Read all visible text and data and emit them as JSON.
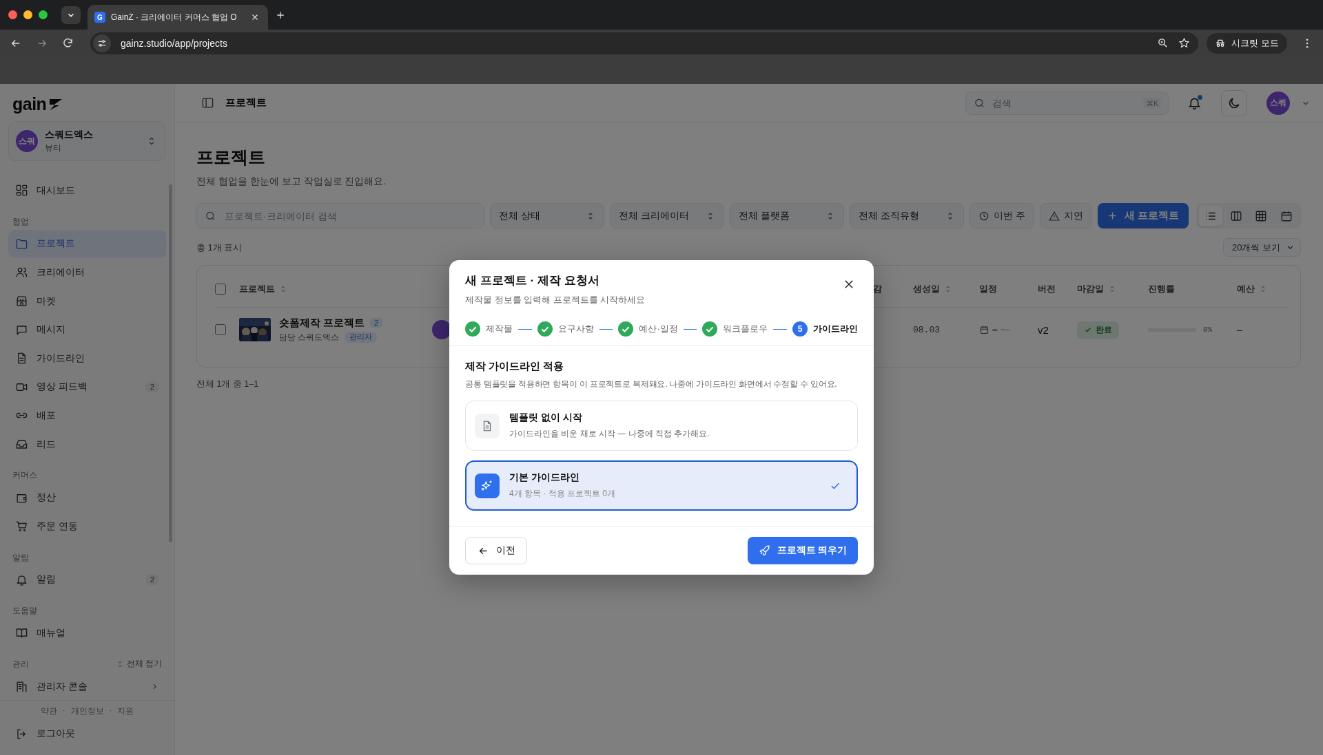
{
  "browser": {
    "favicon": "G",
    "tab_title": "GainZ · 크리에이터 커머스 협업 O",
    "url": "gainz.studio/app/projects",
    "incognito_label": "시크릿 모드"
  },
  "sidebar": {
    "logo": "gain",
    "workspace": {
      "avatar": "스쿼",
      "name": "스쿼드엑스",
      "category": "뷰티"
    },
    "sections": [
      {
        "items": [
          {
            "label": "대시보드",
            "selected": false
          }
        ]
      },
      {
        "label": "협업",
        "items": [
          {
            "label": "프로젝트",
            "selected": true
          },
          {
            "label": "크리에이터",
            "selected": false
          },
          {
            "label": "마켓",
            "selected": false
          },
          {
            "label": "메시지",
            "selected": false
          },
          {
            "label": "가이드라인",
            "selected": false
          },
          {
            "label": "영상 피드백",
            "selected": false,
            "badge": "2"
          },
          {
            "label": "배포",
            "selected": false
          },
          {
            "label": "리드",
            "selected": false
          }
        ]
      },
      {
        "label": "커머스",
        "items": [
          {
            "label": "정산",
            "selected": false
          },
          {
            "label": "주문 연동",
            "selected": false
          }
        ]
      },
      {
        "label": "알림",
        "items": [
          {
            "label": "알림",
            "selected": false,
            "badge": "2"
          }
        ]
      },
      {
        "label": "도움말",
        "items": [
          {
            "label": "매뉴얼",
            "selected": false
          }
        ]
      },
      {
        "label": "관리",
        "action": "전체 접기",
        "items": [
          {
            "label": "관리자 콘솔",
            "selected": false
          }
        ]
      }
    ],
    "footer_links": [
      "약관",
      "개인정보",
      "지원"
    ],
    "footer_separator": "·",
    "logout": "로그아웃"
  },
  "header": {
    "title": "프로젝트",
    "search_placeholder": "검색",
    "shortcut": "⌘K",
    "notification_unread": true,
    "avatar": "스쿼"
  },
  "page": {
    "title": "프로젝트",
    "subtitle": "전체 협업을 한눈에 보고 작업실로 진입해요.",
    "toolbar": {
      "search_placeholder": "프로젝트·크리에이터 검색",
      "filters": [
        "전체 상태",
        "전체 크리에이터",
        "전체 플랫폼",
        "전체 조직유형"
      ],
      "toggles": [
        "이번 주",
        "지연"
      ],
      "new_button": "새 프로젝트",
      "views": [
        {
          "selected": true
        },
        {
          "selected": false
        },
        {
          "selected": false
        },
        {
          "selected": false
        }
      ]
    },
    "summary": "총 1개 표시",
    "page_size": "20개씩 보기",
    "table": {
      "select_all_checked": false,
      "columns": [
        {
          "label": "프로젝트",
          "sortable": true
        },
        {
          "label": "감",
          "sortable": false
        },
        {
          "label": "생성일",
          "sortable": true
        },
        {
          "label": "일정",
          "sortable": false
        },
        {
          "label": "버전",
          "sortable": false
        },
        {
          "label": "마감일",
          "sortable": true
        },
        {
          "label": "진행률",
          "sortable": false
        },
        {
          "label": "예산",
          "sortable": true
        }
      ],
      "rows": [
        {
          "checked": false,
          "title": "숏폼제작 프로젝트",
          "version_count": "2",
          "owner": "담당 스쿼드엑스",
          "role": "관리자",
          "created": "08.03",
          "schedule_start": "–",
          "schedule_end": "~–",
          "version": "v2",
          "deadline_status": "완료",
          "progress": {
            "level": 0,
            "reading": "0%"
          },
          "budget": "–"
        }
      ]
    },
    "pagination": "전체 1개 중 1–1"
  },
  "modal": {
    "title": "새 프로젝트 · 제작 요청서",
    "subtitle": "제작물 정보를 입력해 프로젝트를 시작하세요",
    "steps": [
      {
        "label": "제작물",
        "completed": true,
        "selected": false
      },
      {
        "label": "요구사항",
        "completed": true,
        "selected": false
      },
      {
        "label": "예산·일정",
        "completed": true,
        "selected": false
      },
      {
        "label": "워크플로우",
        "completed": true,
        "selected": false
      },
      {
        "label": "가이드라인",
        "completed": false,
        "selected": true,
        "number": "5"
      }
    ],
    "section_title": "제작 가이드라인 적용",
    "section_desc": "공통 템플릿을 적용하면 항목이 이 프로젝트로 복제돼요. 나중에 가이드라인 화면에서 수정할 수 있어요.",
    "options": [
      {
        "kind": "blank",
        "title": "템플릿 없이 시작",
        "desc": "가이드라인을 비운 채로 시작 — 나중에 직접 추가해요.",
        "selected": false
      },
      {
        "kind": "template",
        "title": "기본 가이드라인",
        "desc": "4개 항목 · 적용 프로젝트 0개",
        "selected": true
      }
    ],
    "back_button": "이전",
    "submit_button": "프로젝트 띄우기"
  }
}
